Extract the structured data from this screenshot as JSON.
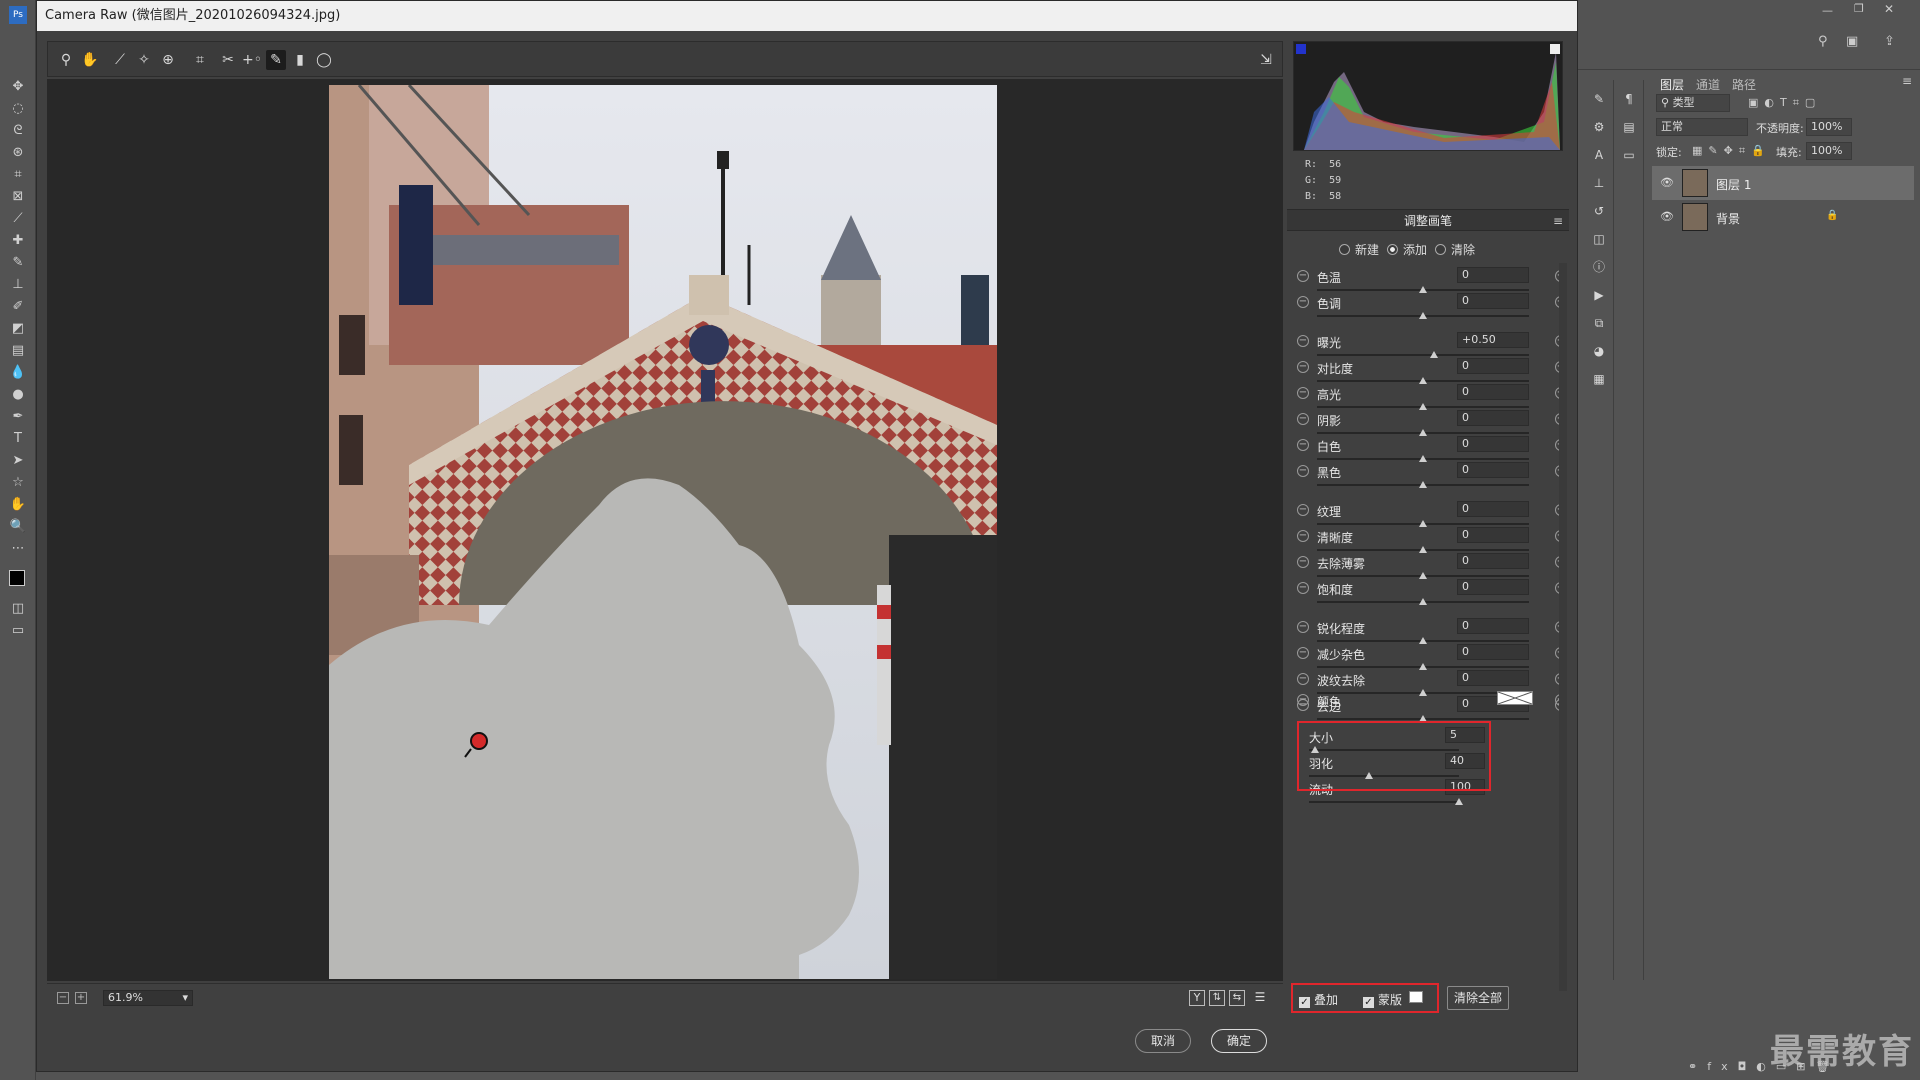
{
  "window": {
    "title": "Camera Raw (微信图片_20201026094324.jpg)"
  },
  "status": {
    "zoom": "61.9%"
  },
  "rgb_readout": {
    "r_label": "R:",
    "r": "56",
    "g_label": "G:",
    "g": "59",
    "b_label": "B:",
    "b": "58"
  },
  "panel": {
    "title": "调整画笔",
    "modes": [
      "新建",
      "添加",
      "清除"
    ],
    "selected_mode": "添加",
    "sliders": [
      {
        "label": "色温",
        "value": "0",
        "pos": 0.5
      },
      {
        "label": "色调",
        "value": "0",
        "pos": 0.5
      },
      {
        "label": "曝光",
        "value": "+0.50",
        "pos": 0.55
      },
      {
        "label": "对比度",
        "value": "0",
        "pos": 0.5
      },
      {
        "label": "高光",
        "value": "0",
        "pos": 0.5
      },
      {
        "label": "阴影",
        "value": "0",
        "pos": 0.5
      },
      {
        "label": "白色",
        "value": "0",
        "pos": 0.5
      },
      {
        "label": "黑色",
        "value": "0",
        "pos": 0.5
      },
      {
        "label": "纹理",
        "value": "0",
        "pos": 0.5
      },
      {
        "label": "清晰度",
        "value": "0",
        "pos": 0.5
      },
      {
        "label": "去除薄雾",
        "value": "0",
        "pos": 0.5
      },
      {
        "label": "饱和度",
        "value": "0",
        "pos": 0.5
      },
      {
        "label": "锐化程度",
        "value": "0",
        "pos": 0.5
      },
      {
        "label": "减少杂色",
        "value": "0",
        "pos": 0.5
      },
      {
        "label": "波纹去除",
        "value": "0",
        "pos": 0.5
      },
      {
        "label": "去边",
        "value": "0",
        "pos": 0.5
      }
    ],
    "color_label": "颜色",
    "brush": [
      {
        "label": "大小",
        "value": "5",
        "pos": 0.04
      },
      {
        "label": "羽化",
        "value": "40",
        "pos": 0.4
      },
      {
        "label": "流动",
        "value": "100",
        "pos": 1.0
      }
    ],
    "overlay_label": "叠加",
    "mask_label": "蒙版",
    "clear_all": "清除全部"
  },
  "dialog": {
    "cancel": "取消",
    "ok": "确定"
  },
  "layers": {
    "tabs": [
      "图层",
      "通道",
      "路径"
    ],
    "kind": "类型",
    "blend": "正常",
    "opacity_label": "不透明度:",
    "opacity": "100%",
    "lock_label": "锁定:",
    "fill_label": "填充:",
    "fill": "100%",
    "items": [
      {
        "name": "图层 1"
      },
      {
        "name": "背景"
      }
    ]
  },
  "watermark": "最需教育"
}
